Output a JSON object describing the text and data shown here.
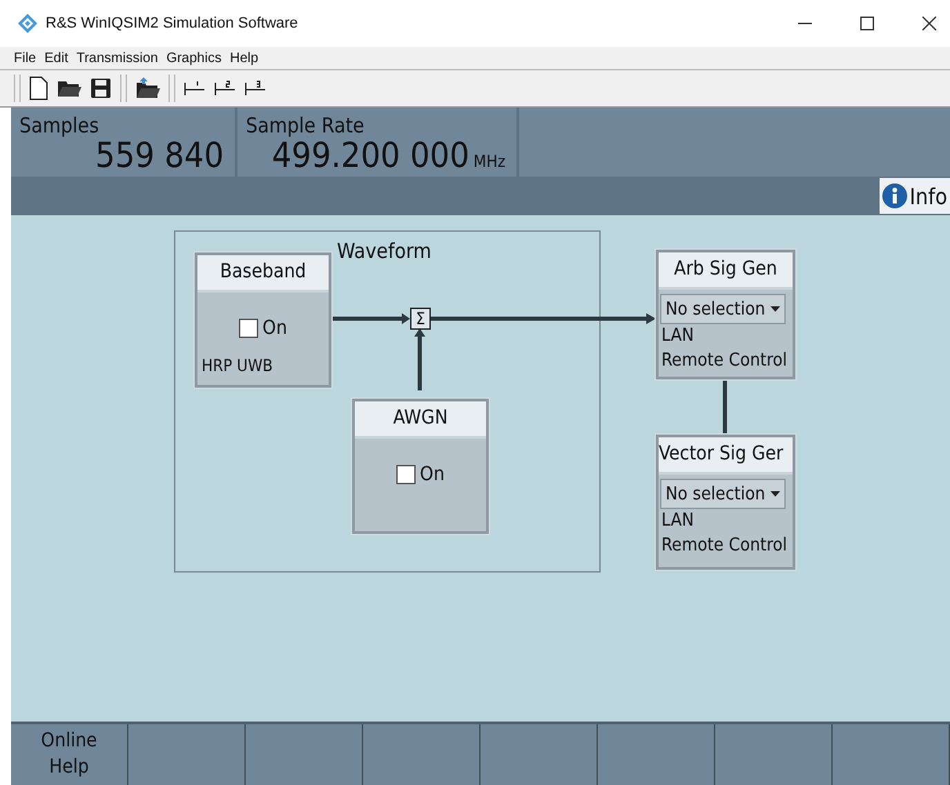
{
  "window": {
    "title": "R&S WinIQSIM2 Simulation Software"
  },
  "menu": [
    "File",
    "Edit",
    "Transmission",
    "Graphics",
    "Help"
  ],
  "status": [
    {
      "label": "Samples",
      "value": "559 840"
    },
    {
      "label": "Sample Rate",
      "value": "499.200 000",
      "unit": "MHz"
    }
  ],
  "info_button": {
    "label": "Info"
  },
  "diagram": {
    "frame_title": "Waveform",
    "blocks": [
      {
        "kind": "toggle",
        "title": "Baseband",
        "checkbox": {
          "label": "On",
          "checked": false
        },
        "note": "HRP UWB"
      },
      {
        "kind": "toggle",
        "title": "AWGN",
        "checkbox": {
          "label": "On",
          "checked": false
        }
      },
      {
        "kind": "instrument",
        "title": "Arb Sig Gen",
        "dropdown": "No selection",
        "lines": [
          "LAN",
          "Remote Control"
        ]
      },
      {
        "kind": "instrument",
        "title": "Vector Sig Ger",
        "dropdown": "No selection",
        "lines": [
          "LAN",
          "Remote Control"
        ]
      }
    ],
    "sum_symbol": "Σ"
  },
  "softkeys": [
    {
      "kind": "label",
      "label": "Online\nHelp"
    },
    {
      "kind": "empty"
    },
    {
      "kind": "empty"
    },
    {
      "kind": "empty"
    },
    {
      "kind": "empty"
    },
    {
      "kind": "empty"
    },
    {
      "kind": "empty"
    },
    {
      "kind": "empty"
    }
  ]
}
